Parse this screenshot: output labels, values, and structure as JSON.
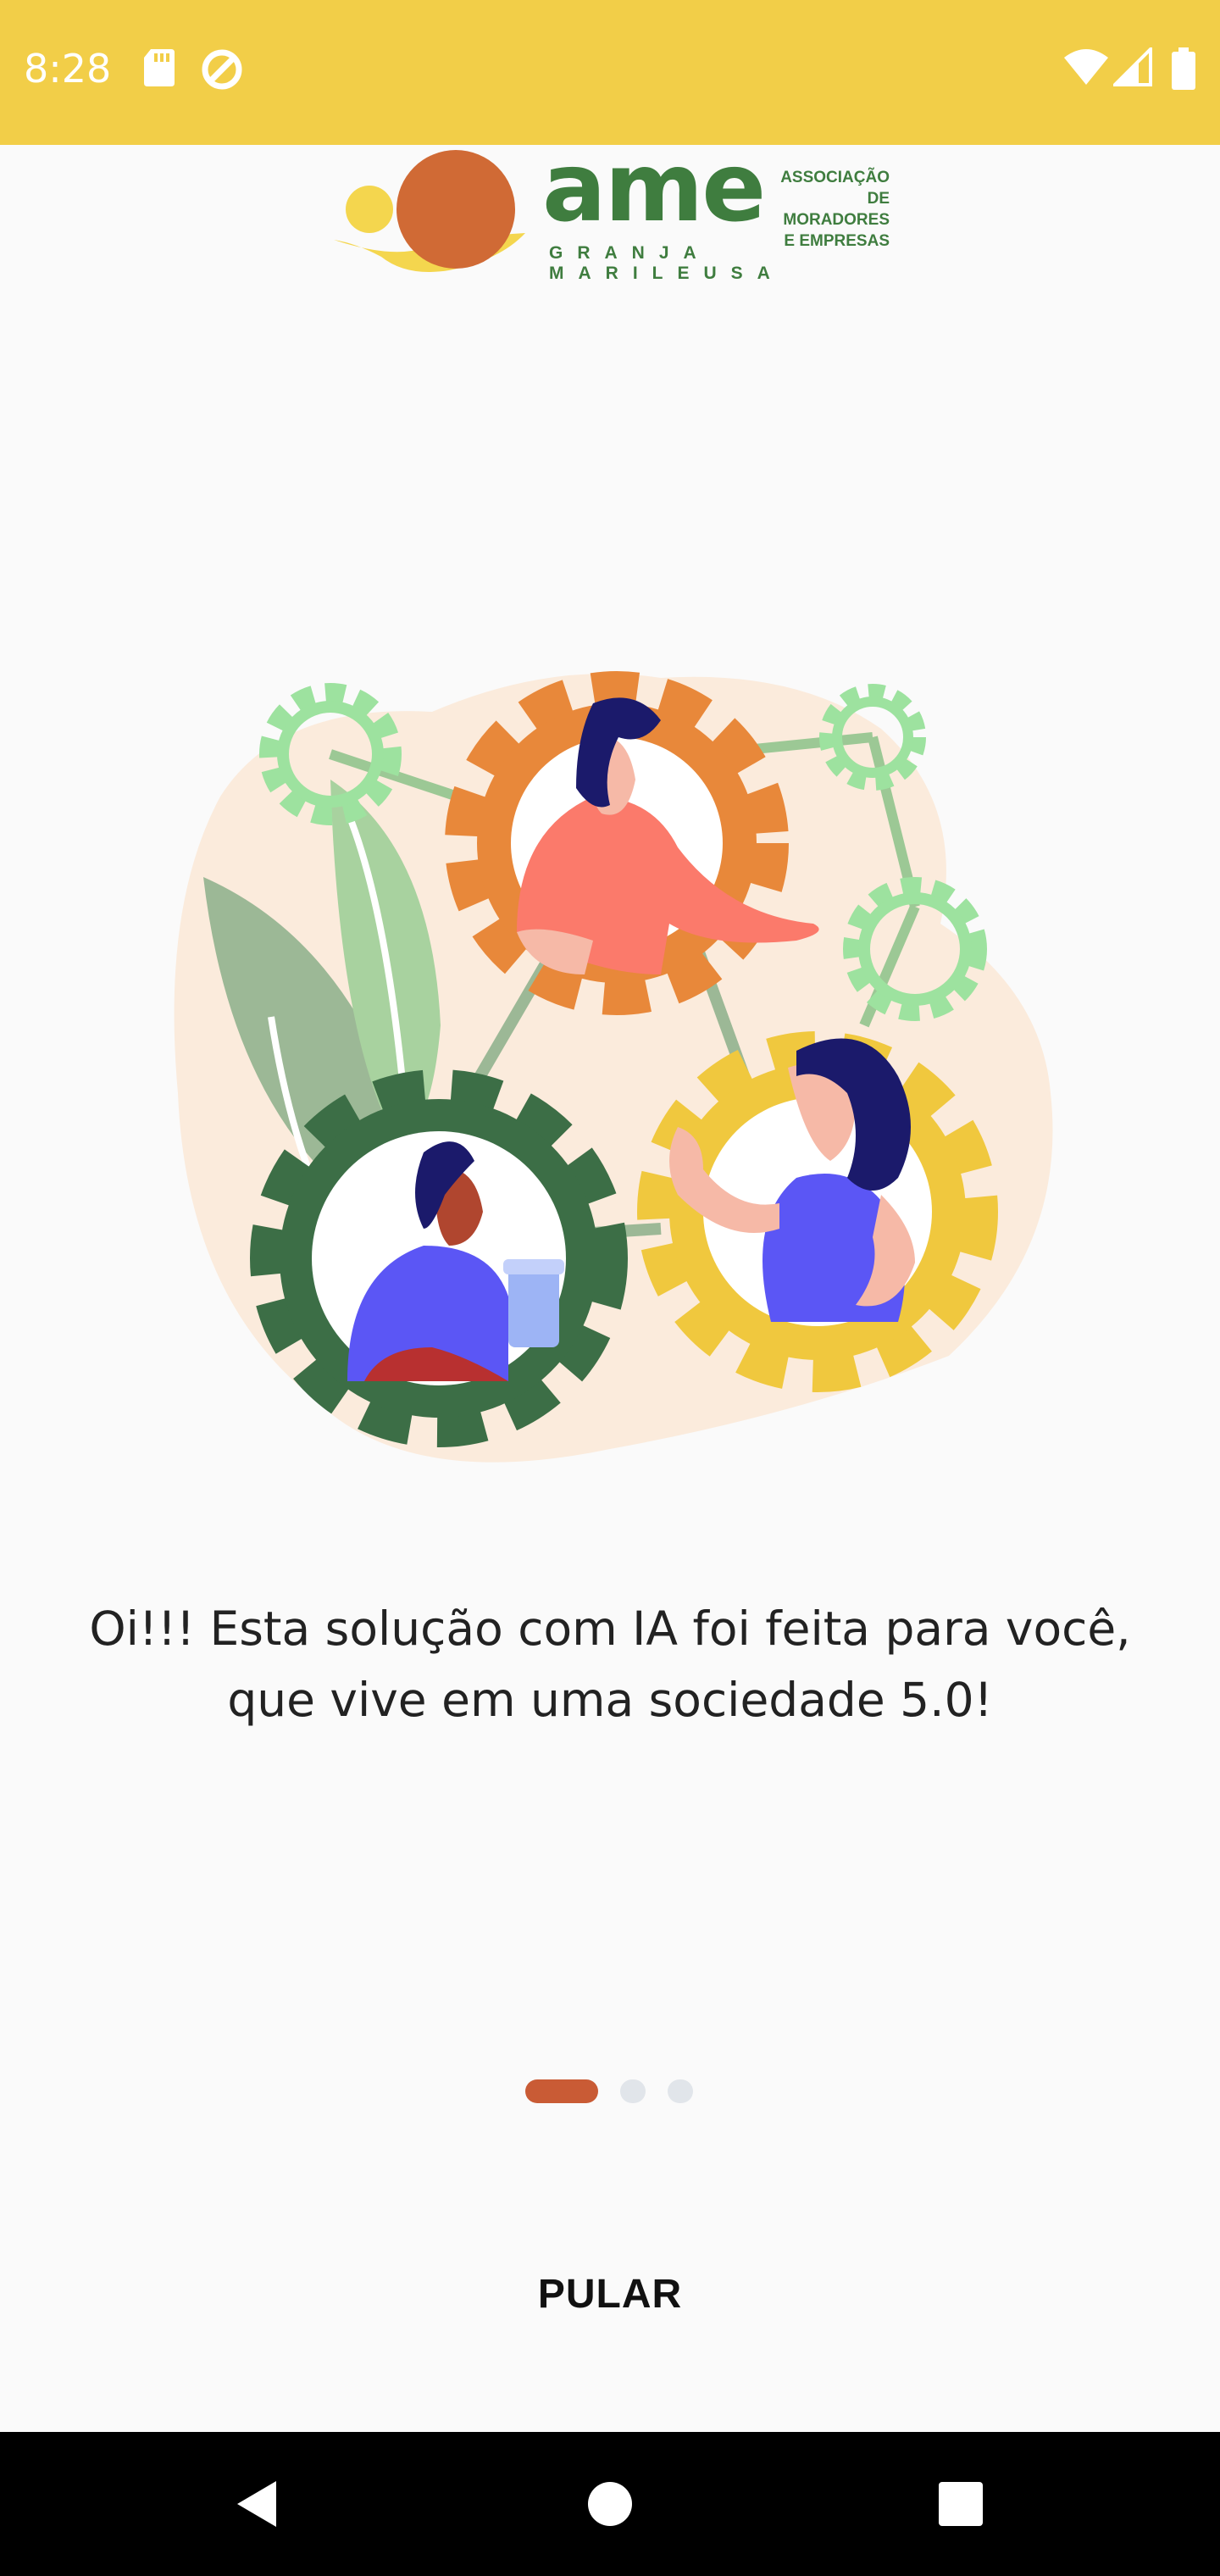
{
  "status_bar": {
    "time": "8:28",
    "background_color": "#f2ce48",
    "left_icons": [
      "sd-card-icon",
      "data-saver-icon"
    ],
    "right_icons": [
      "wifi-icon",
      "cell-signal-icon",
      "battery-icon"
    ]
  },
  "logo": {
    "wordmark": "ame",
    "subtitle_line1": "ASSOCIAÇÃO DE",
    "subtitle_line2": "MORADORES",
    "subtitle_line3": "E EMPRESAS",
    "place": "GRANJA MARILEUSA",
    "brand_color": "#3f7d3f"
  },
  "onboarding": {
    "illustration": "people-in-connected-gears-illustration",
    "message_line1": "Oi!!! Esta solução com IA foi feita para você,",
    "message_line2": "que vive em uma sociedade 5.0!",
    "page_indicator": {
      "current": 1,
      "total": 3,
      "active_color": "#c95b35",
      "inactive_color": "#e1e5ea"
    },
    "skip_label": "PULAR"
  },
  "nav_bar": {
    "icons": [
      "back-icon",
      "home-icon",
      "recents-icon"
    ]
  }
}
